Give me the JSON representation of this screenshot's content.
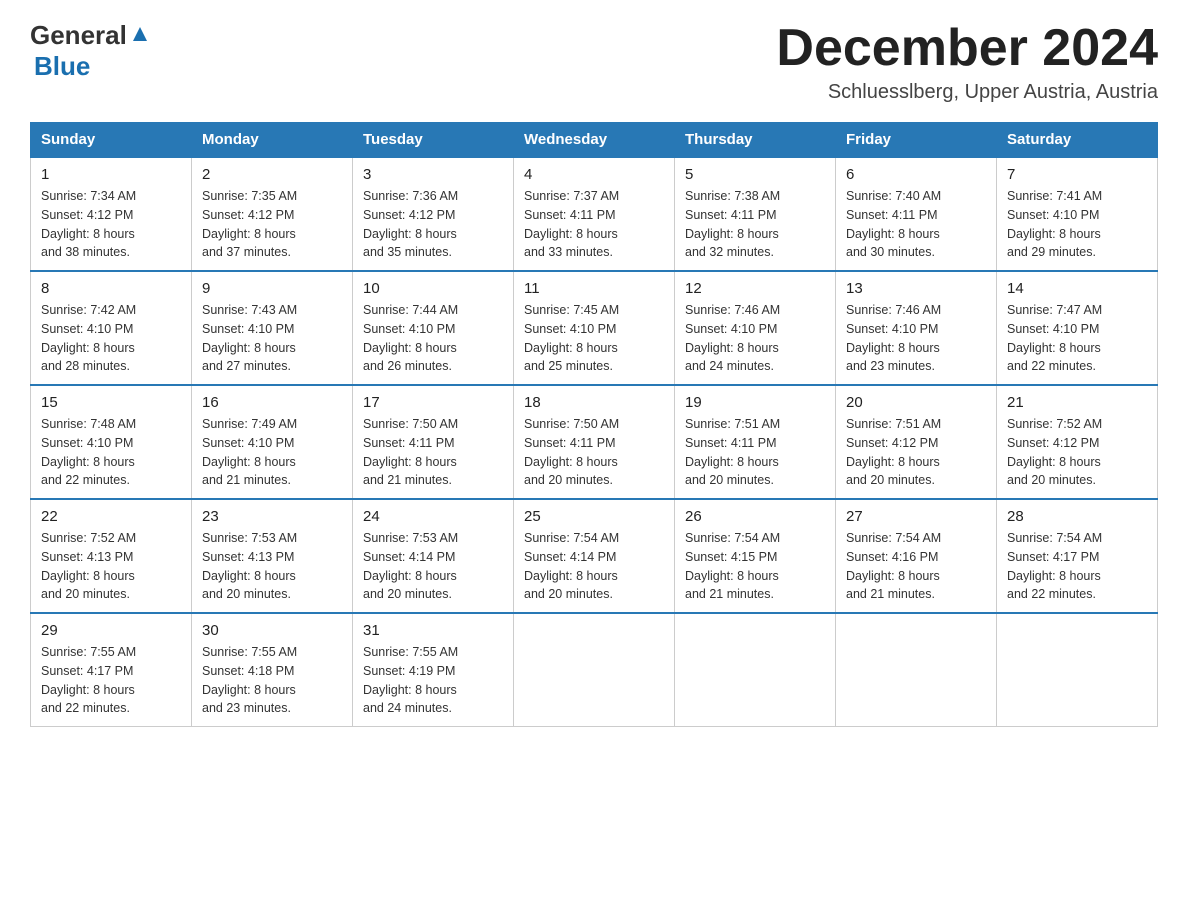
{
  "logo": {
    "general": "General",
    "blue": "Blue"
  },
  "title": {
    "month_year": "December 2024",
    "location": "Schluesslberg, Upper Austria, Austria"
  },
  "days_of_week": [
    "Sunday",
    "Monday",
    "Tuesday",
    "Wednesday",
    "Thursday",
    "Friday",
    "Saturday"
  ],
  "weeks": [
    [
      {
        "day": "1",
        "sunrise": "7:34 AM",
        "sunset": "4:12 PM",
        "daylight": "8 hours and 38 minutes."
      },
      {
        "day": "2",
        "sunrise": "7:35 AM",
        "sunset": "4:12 PM",
        "daylight": "8 hours and 37 minutes."
      },
      {
        "day": "3",
        "sunrise": "7:36 AM",
        "sunset": "4:12 PM",
        "daylight": "8 hours and 35 minutes."
      },
      {
        "day": "4",
        "sunrise": "7:37 AM",
        "sunset": "4:11 PM",
        "daylight": "8 hours and 33 minutes."
      },
      {
        "day": "5",
        "sunrise": "7:38 AM",
        "sunset": "4:11 PM",
        "daylight": "8 hours and 32 minutes."
      },
      {
        "day": "6",
        "sunrise": "7:40 AM",
        "sunset": "4:11 PM",
        "daylight": "8 hours and 30 minutes."
      },
      {
        "day": "7",
        "sunrise": "7:41 AM",
        "sunset": "4:10 PM",
        "daylight": "8 hours and 29 minutes."
      }
    ],
    [
      {
        "day": "8",
        "sunrise": "7:42 AM",
        "sunset": "4:10 PM",
        "daylight": "8 hours and 28 minutes."
      },
      {
        "day": "9",
        "sunrise": "7:43 AM",
        "sunset": "4:10 PM",
        "daylight": "8 hours and 27 minutes."
      },
      {
        "day": "10",
        "sunrise": "7:44 AM",
        "sunset": "4:10 PM",
        "daylight": "8 hours and 26 minutes."
      },
      {
        "day": "11",
        "sunrise": "7:45 AM",
        "sunset": "4:10 PM",
        "daylight": "8 hours and 25 minutes."
      },
      {
        "day": "12",
        "sunrise": "7:46 AM",
        "sunset": "4:10 PM",
        "daylight": "8 hours and 24 minutes."
      },
      {
        "day": "13",
        "sunrise": "7:46 AM",
        "sunset": "4:10 PM",
        "daylight": "8 hours and 23 minutes."
      },
      {
        "day": "14",
        "sunrise": "7:47 AM",
        "sunset": "4:10 PM",
        "daylight": "8 hours and 22 minutes."
      }
    ],
    [
      {
        "day": "15",
        "sunrise": "7:48 AM",
        "sunset": "4:10 PM",
        "daylight": "8 hours and 22 minutes."
      },
      {
        "day": "16",
        "sunrise": "7:49 AM",
        "sunset": "4:10 PM",
        "daylight": "8 hours and 21 minutes."
      },
      {
        "day": "17",
        "sunrise": "7:50 AM",
        "sunset": "4:11 PM",
        "daylight": "8 hours and 21 minutes."
      },
      {
        "day": "18",
        "sunrise": "7:50 AM",
        "sunset": "4:11 PM",
        "daylight": "8 hours and 20 minutes."
      },
      {
        "day": "19",
        "sunrise": "7:51 AM",
        "sunset": "4:11 PM",
        "daylight": "8 hours and 20 minutes."
      },
      {
        "day": "20",
        "sunrise": "7:51 AM",
        "sunset": "4:12 PM",
        "daylight": "8 hours and 20 minutes."
      },
      {
        "day": "21",
        "sunrise": "7:52 AM",
        "sunset": "4:12 PM",
        "daylight": "8 hours and 20 minutes."
      }
    ],
    [
      {
        "day": "22",
        "sunrise": "7:52 AM",
        "sunset": "4:13 PM",
        "daylight": "8 hours and 20 minutes."
      },
      {
        "day": "23",
        "sunrise": "7:53 AM",
        "sunset": "4:13 PM",
        "daylight": "8 hours and 20 minutes."
      },
      {
        "day": "24",
        "sunrise": "7:53 AM",
        "sunset": "4:14 PM",
        "daylight": "8 hours and 20 minutes."
      },
      {
        "day": "25",
        "sunrise": "7:54 AM",
        "sunset": "4:14 PM",
        "daylight": "8 hours and 20 minutes."
      },
      {
        "day": "26",
        "sunrise": "7:54 AM",
        "sunset": "4:15 PM",
        "daylight": "8 hours and 21 minutes."
      },
      {
        "day": "27",
        "sunrise": "7:54 AM",
        "sunset": "4:16 PM",
        "daylight": "8 hours and 21 minutes."
      },
      {
        "day": "28",
        "sunrise": "7:54 AM",
        "sunset": "4:17 PM",
        "daylight": "8 hours and 22 minutes."
      }
    ],
    [
      {
        "day": "29",
        "sunrise": "7:55 AM",
        "sunset": "4:17 PM",
        "daylight": "8 hours and 22 minutes."
      },
      {
        "day": "30",
        "sunrise": "7:55 AM",
        "sunset": "4:18 PM",
        "daylight": "8 hours and 23 minutes."
      },
      {
        "day": "31",
        "sunrise": "7:55 AM",
        "sunset": "4:19 PM",
        "daylight": "8 hours and 24 minutes."
      },
      null,
      null,
      null,
      null
    ]
  ],
  "labels": {
    "sunrise": "Sunrise:",
    "sunset": "Sunset:",
    "daylight": "Daylight:"
  }
}
